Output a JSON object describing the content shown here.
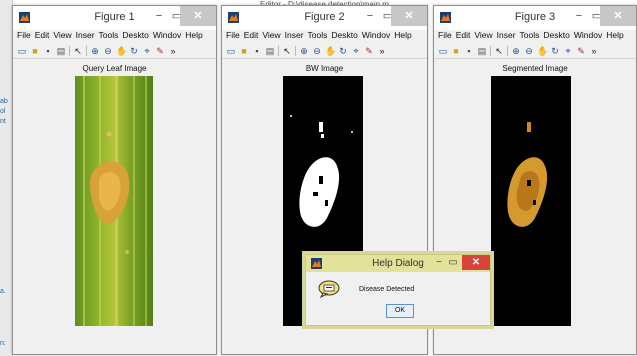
{
  "colors": {
    "accent": "#c7c7c7",
    "dialog_close": "#d9443a",
    "dialog_frame": "#d7d79a"
  },
  "background": {
    "partial_title": "Editor - D:\\disease detection\\main.m",
    "left_fragments": [
      "ab",
      "ol",
      "nt",
      "a.",
      "n:"
    ]
  },
  "menu": [
    "File",
    "Edit",
    "View",
    "Inser",
    "Tools",
    "Deskto",
    "Windov",
    "Help"
  ],
  "toolbar_icons": [
    "new-figure-icon",
    "open-file-icon",
    "save-icon",
    "print-icon",
    "pointer-icon",
    "zoom-in-icon",
    "zoom-out-icon",
    "pan-icon",
    "rotate-icon",
    "data-cursor-icon",
    "brush-icon",
    "overflow-icon"
  ],
  "figures": [
    {
      "title": "Figure 1",
      "axes_title": "Query Leaf Image",
      "minimize": "−",
      "maximize": "▭",
      "close": "✕"
    },
    {
      "title": "Figure 2",
      "axes_title": "BW Image",
      "minimize": "−",
      "maximize": "▭",
      "close": "✕"
    },
    {
      "title": "Figure 3",
      "axes_title": "Segmented Image",
      "minimize": "−",
      "maximize": "▭",
      "close": "✕"
    }
  ],
  "dialog": {
    "title": "Help Dialog",
    "message": "Disease Detected",
    "ok_label": "OK",
    "minimize": "−",
    "maximize": "▭",
    "close": "✕"
  }
}
